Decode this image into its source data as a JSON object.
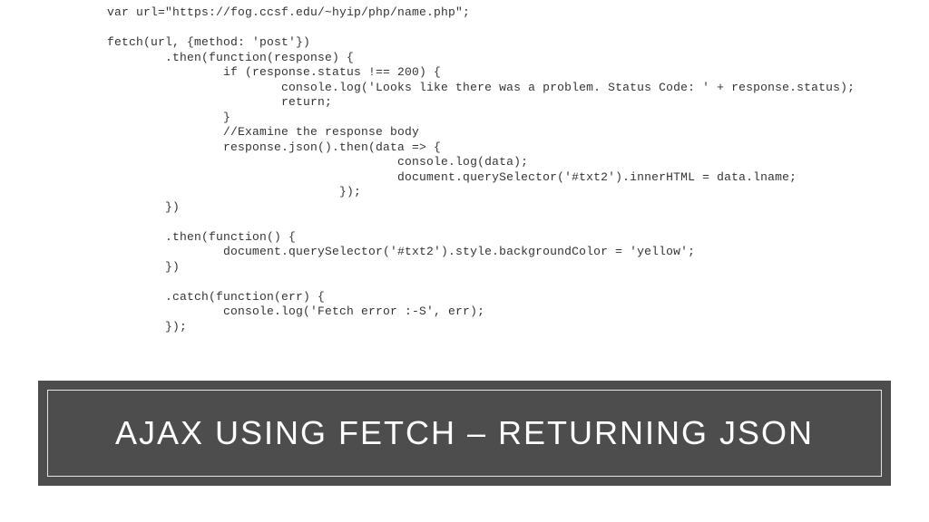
{
  "code": {
    "lines": [
      "var url=\"https://fog.ccsf.edu/~hyip/php/name.php\";",
      "",
      "fetch(url, {method: 'post'})",
      "        .then(function(response) {",
      "                if (response.status !== 200) {",
      "                        console.log('Looks like there was a problem. Status Code: ' + response.status);",
      "                        return;",
      "                }",
      "                //Examine the response body",
      "                response.json().then(data => {",
      "                                        console.log(data);",
      "                                        document.querySelector('#txt2').innerHTML = data.lname;",
      "                                });",
      "        })",
      "",
      "        .then(function() {",
      "                document.querySelector('#txt2').style.backgroundColor = 'yellow';",
      "        })",
      "",
      "        .catch(function(err) {",
      "                console.log('Fetch error :-S', err);",
      "        });"
    ]
  },
  "title": {
    "text": "AJAX USING FETCH – RETURNING JSON"
  },
  "colors": {
    "banner_bg": "#4D4D4D",
    "banner_border": "#e6e6e6",
    "code_color": "#333333",
    "background": "#ffffff"
  }
}
